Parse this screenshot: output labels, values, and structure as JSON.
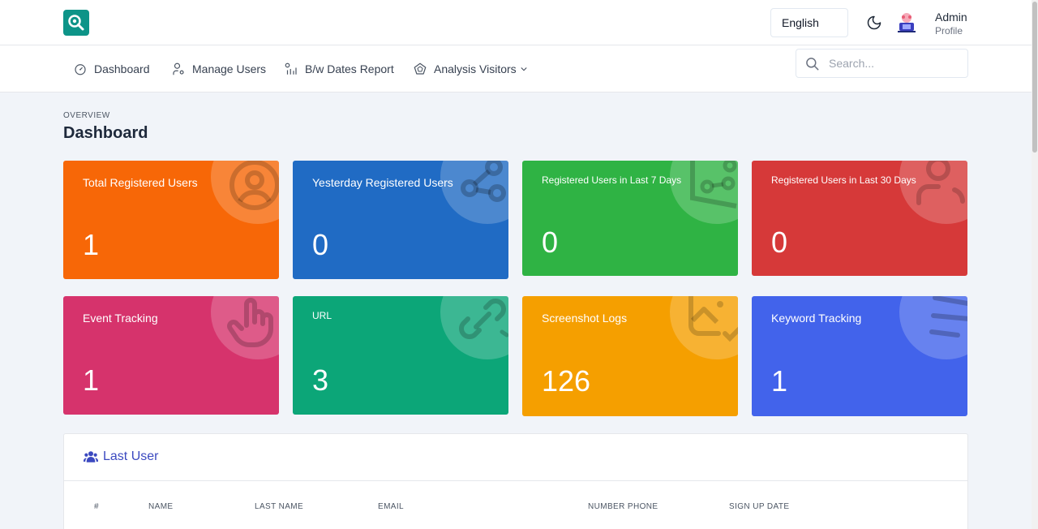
{
  "header": {
    "language": "English",
    "user_name": "Admin",
    "user_sub": "Profile"
  },
  "nav": {
    "items": [
      {
        "label": "Dashboard",
        "icon": "gauge-icon"
      },
      {
        "label": "Manage Users",
        "icon": "user-settings-icon"
      },
      {
        "label": "B/w Dates Report",
        "icon": "report-icon"
      },
      {
        "label": "Analysis Visitors",
        "icon": "radar-icon"
      }
    ],
    "search_placeholder": "Search..."
  },
  "page": {
    "overline": "OVERVIEW",
    "title": "Dashboard"
  },
  "cards": [
    {
      "label": "Total Registered Users",
      "value": "1",
      "color": "#f76707"
    },
    {
      "label": "Yesterday Registered Users",
      "value": "0",
      "color": "#206bc4"
    },
    {
      "label": "Registered Users in Last 7 Days",
      "value": "0",
      "color": "#2fb344"
    },
    {
      "label": "Registered Users in Last 30 Days",
      "value": "0",
      "color": "#d63939"
    },
    {
      "label": "Event Tracking",
      "value": "1",
      "color": "#d6336c"
    },
    {
      "label": "URL",
      "value": "3",
      "color": "#0ca678"
    },
    {
      "label": "Screenshot Logs",
      "value": "126",
      "color": "#f59f00"
    },
    {
      "label": "Keyword Tracking",
      "value": "1",
      "color": "#4263eb"
    }
  ],
  "last_user": {
    "title": "Last User",
    "columns": [
      "#",
      "NAME",
      "LAST NAME",
      "EMAIL",
      "NUMBER PHONE",
      "SIGN UP DATE"
    ]
  }
}
